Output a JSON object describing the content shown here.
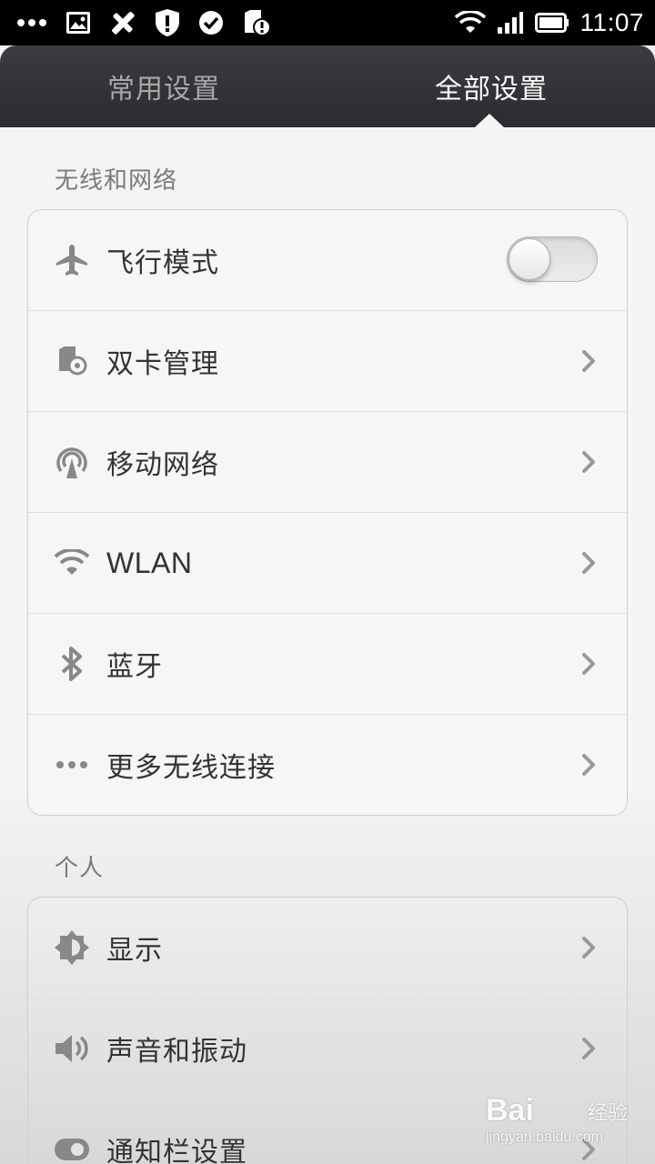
{
  "status_bar": {
    "time": "11:07",
    "left_icons": [
      "more-dots-icon",
      "image-icon",
      "tools-icon",
      "shield-alert-icon",
      "check-circle-icon",
      "sd-card-alert-icon"
    ],
    "right_icons": [
      "wifi-icon",
      "signal-icon",
      "battery-icon"
    ]
  },
  "tabs": [
    {
      "label": "常用设置",
      "active": false
    },
    {
      "label": "全部设置",
      "active": true
    }
  ],
  "sections": [
    {
      "title": "无线和网络",
      "items": [
        {
          "label": "飞行模式",
          "icon": "airplane-icon",
          "control": "toggle",
          "toggle_state": "off"
        },
        {
          "label": "双卡管理",
          "icon": "dual-sim-icon",
          "control": "chevron"
        },
        {
          "label": "移动网络",
          "icon": "cellular-network-icon",
          "control": "chevron"
        },
        {
          "label": "WLAN",
          "icon": "wifi-icon",
          "control": "chevron"
        },
        {
          "label": "蓝牙",
          "icon": "bluetooth-icon",
          "control": "chevron"
        },
        {
          "label": "更多无线连接",
          "icon": "more-dots-icon",
          "control": "chevron"
        }
      ]
    },
    {
      "title": "个人",
      "items": [
        {
          "label": "显示",
          "icon": "brightness-icon",
          "control": "chevron"
        },
        {
          "label": "声音和振动",
          "icon": "speaker-icon",
          "control": "chevron"
        },
        {
          "label": "通知栏设置",
          "icon": "notification-toggle-icon",
          "control": "chevron"
        }
      ]
    }
  ],
  "watermark": {
    "brand": "Bai",
    "sub": "经验",
    "url": "jingyan.baidu.com"
  },
  "colors": {
    "tabbar_bg": "#2f3134",
    "active_tab_text": "#ffffff",
    "inactive_tab_text": "#a8a8a8",
    "section_title": "#7a7a7a",
    "row_text": "#333333",
    "icon_gray": "#888888"
  }
}
